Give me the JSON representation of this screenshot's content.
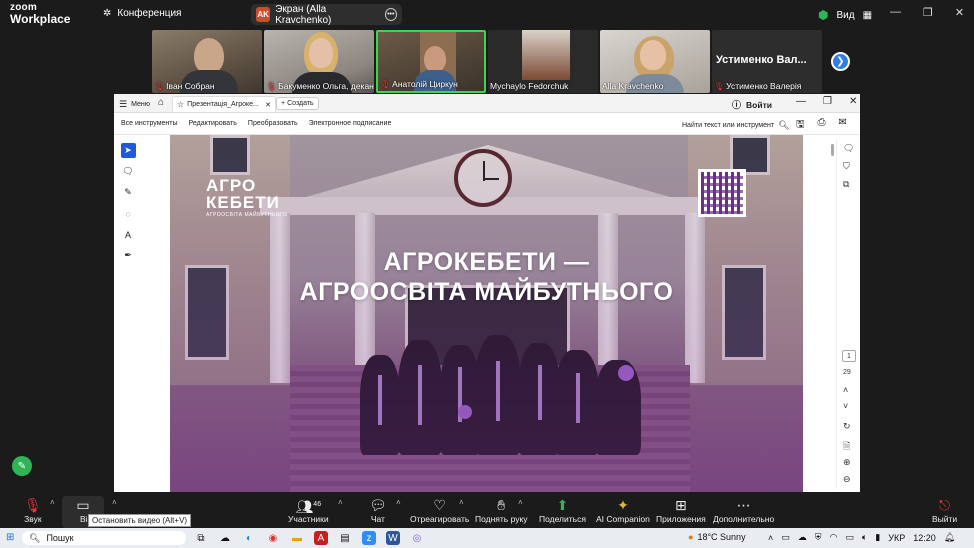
{
  "app": {
    "logo_line1": "zoom",
    "logo_line2": "Workplace",
    "meeting_label": "Конференция",
    "view_label": "Вид"
  },
  "share": {
    "badge": "AK",
    "label": "Экран (Alla Kravchenko)"
  },
  "participants": [
    {
      "name": "Іван Собран",
      "muted": true
    },
    {
      "name": "Бакуменко Ольга, декан",
      "muted": true
    },
    {
      "name": "Анатолій Циркун",
      "muted": true
    },
    {
      "name": "Mychaylo Fedorchuk",
      "muted": false
    },
    {
      "name": "Alla Kravchenko",
      "muted": false
    },
    {
      "name": "Устименко Валерія",
      "muted": true,
      "tile_text": "Устименко Вал..."
    }
  ],
  "acrobat": {
    "menu_label": "Меню",
    "tab_title": "Презентація_Агроке...",
    "create_label": "Создать",
    "signin_label": "Войти",
    "tools": [
      "Все инструменты",
      "Редактировать",
      "Преобразовать",
      "Электронное подписание"
    ],
    "search_label": "Найти текст или инструмент",
    "page_current": "1",
    "page_total": "29"
  },
  "slide": {
    "logo_main": "АГРО КЕБЕТИ",
    "logo_sub": "АГРООСВІТА МАЙБУТНЬОГО",
    "headline_line1": "АГРОКЕБЕТИ —",
    "headline_line2": "АГРООСВІТА МАЙБУТНЬОГО"
  },
  "toolbar": {
    "audio": "Звук",
    "video": "Ві",
    "tooltip": "Остановить видео (Alt+V)",
    "participants": "Участники",
    "participants_count": "46",
    "chat": "Чат",
    "react": "Отреагировать",
    "raise_hand": "Поднять руку",
    "share": "Поделиться",
    "ai": "AI Companion",
    "apps": "Приложения",
    "more": "Дополнительно",
    "leave": "Выйти"
  },
  "taskbar": {
    "search": "Пошук",
    "weather": "18°C  Sunny",
    "lang": "УКР",
    "time": "12:20"
  },
  "colors": {
    "active_border": "#3fd44f",
    "accent_blue": "#2f7ee8",
    "share_green": "#2fb457",
    "leave_red": "#e33"
  }
}
